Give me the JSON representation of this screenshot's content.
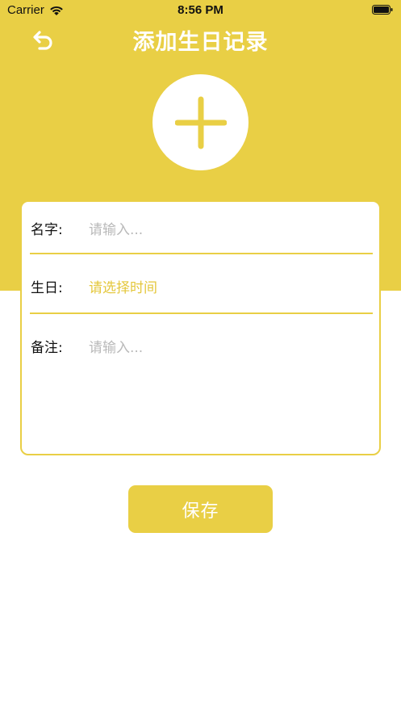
{
  "status_bar": {
    "carrier": "Carrier",
    "time": "8:56 PM",
    "wifi_icon": "wifi-icon",
    "battery_icon": "battery-full-icon"
  },
  "nav": {
    "title": "添加生日记录",
    "back_icon": "undo-arrow-icon"
  },
  "avatar": {
    "icon": "plus-icon"
  },
  "form": {
    "name": {
      "label": "名字:",
      "placeholder": "请输入..."
    },
    "birthday": {
      "label": "生日:",
      "value": "请选择时间"
    },
    "note": {
      "label": "备注:",
      "placeholder": "请输入..."
    }
  },
  "actions": {
    "save_label": "保存"
  },
  "colors": {
    "accent": "#E9CF45",
    "background": "#FFFFFF",
    "placeholder": "#B9B9B9"
  }
}
